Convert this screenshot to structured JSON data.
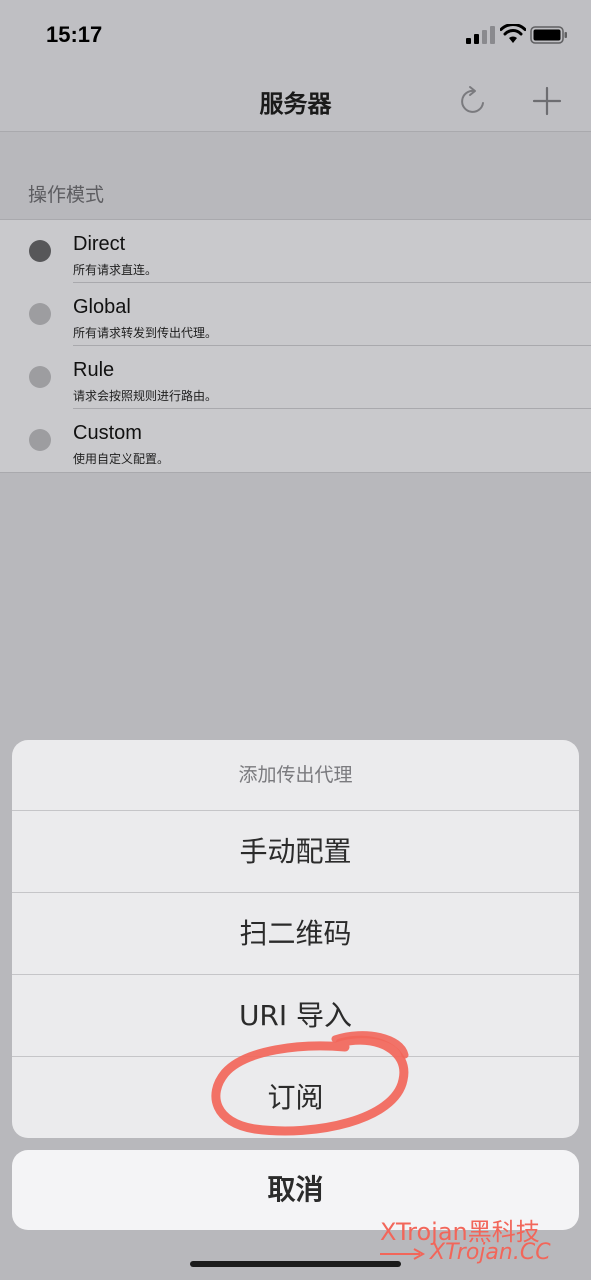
{
  "status_bar": {
    "time": "15:17",
    "icons": [
      "cellular-signal-icon",
      "wifi-icon",
      "battery-icon"
    ]
  },
  "nav": {
    "title": "服务器",
    "actions": [
      "refresh-icon",
      "plus-icon"
    ]
  },
  "mode_section": {
    "header": "操作模式",
    "items": [
      {
        "title": "Direct",
        "subtitle": "所有请求直连。",
        "selected": true
      },
      {
        "title": "Global",
        "subtitle": "所有请求转发到传出代理。",
        "selected": false
      },
      {
        "title": "Rule",
        "subtitle": "请求会按照规则进行路由。",
        "selected": false
      },
      {
        "title": "Custom",
        "subtitle": "使用自定义配置。",
        "selected": false
      }
    ]
  },
  "action_sheet": {
    "title": "添加传出代理",
    "options": [
      "手动配置",
      "扫二维码",
      "URI 导入",
      "订阅"
    ],
    "cancel": "取消"
  },
  "watermark": {
    "line1": "XTrojan黑科技",
    "line2": "XTrojan.CC"
  },
  "colors": {
    "annotation": "#f2665a",
    "selected_dot": "#575759",
    "unselected_dot": "#9d9da0"
  }
}
